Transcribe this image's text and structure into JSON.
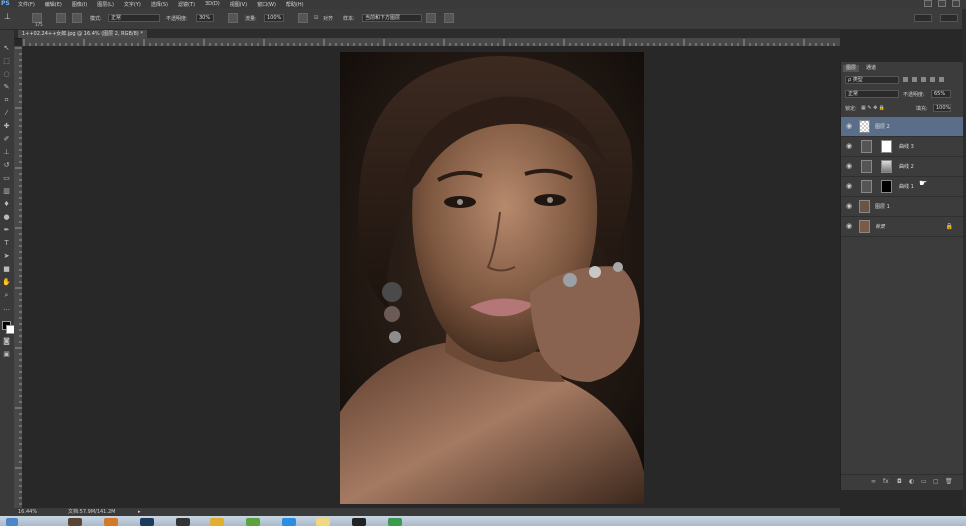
{
  "app": {
    "logo": "PS"
  },
  "menu": [
    "文件(F)",
    "编辑(E)",
    "图像(I)",
    "图层(L)",
    "文字(Y)",
    "选择(S)",
    "滤镜(T)",
    "3D(D)",
    "视图(V)",
    "窗口(W)",
    "帮助(H)"
  ],
  "options_bar": {
    "brush_size": "175",
    "mode_label": "模式:",
    "mode_value": "正常",
    "opacity_label": "不透明度:",
    "opacity_value": "30%",
    "flow_label": "流量:",
    "flow_value": "100%",
    "aligned_label": "对齐",
    "sample_label": "样本:",
    "sample_value": "当前和下方图层"
  },
  "document": {
    "tab_title": "1++02.24++女郎.jpg @ 16.4% (图层 2, RGB/8) *",
    "zoom": "16.44%",
    "doc_info": "文档:57.9M/141.2M"
  },
  "layers_panel": {
    "tabs": [
      "图层",
      "通道"
    ],
    "filter_label": "ρ 类型",
    "blend_mode": "正常",
    "opacity_label": "不透明度:",
    "opacity_value": "65%",
    "lock_label": "锁定:",
    "fill_label": "填充:",
    "fill_value": "100%",
    "layers": [
      {
        "name": "图层 2"
      },
      {
        "name": "曲线 3"
      },
      {
        "name": "曲线 2"
      },
      {
        "name": "曲线 1"
      },
      {
        "name": "图层 1"
      },
      {
        "name": "背景"
      }
    ],
    "footer_icons": [
      "link-icon",
      "fx-icon",
      "mask-icon",
      "adjustment-icon",
      "group-icon",
      "new-layer-icon",
      "trash-icon"
    ]
  },
  "colors": {
    "accent": "#5a6e8a",
    "ui_dark": "#282828",
    "panel": "#3c3c3c"
  }
}
